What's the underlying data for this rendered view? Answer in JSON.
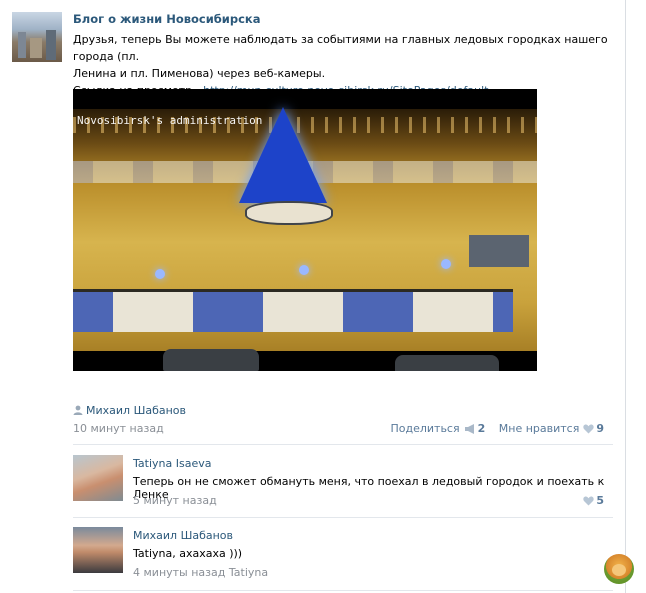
{
  "post": {
    "title": "Блог о жизни Новосибирска",
    "text_line1": "Друзья, теперь Вы можете наблюдать за событиями на главных ледовых городках нашего города (пл.",
    "text_line2": "Ленина и пл. Пименова) через веб-камеры.",
    "link_prefix": "Ссылка на просмотр - ",
    "link_text": "http://mun-culture.novo-sibirsk.ru/SitePages/default...",
    "video_caption": "Novosibirsk's administration",
    "author": "Михаил Шабанов",
    "time": "10 минут назад",
    "share_label": "Поделиться",
    "share_count": "2",
    "like_label": "Мне нравится",
    "like_count": "9"
  },
  "comments": [
    {
      "name": "Tatiyna Isaeva",
      "text": "Теперь он не сможет обмануть меня, что поехал в ледовый городок и поехать к Ленке",
      "time": "5 минут назад",
      "likes": "5"
    },
    {
      "name": "Михаил Шабанов",
      "text": "Tatiyna, ахахаха )))",
      "time": "4 минуты назад",
      "reply_to": "Tatiyna"
    }
  ],
  "colors": {
    "link": "#2b587a",
    "meta": "#8a8f96",
    "action": "#5a7a9a"
  }
}
